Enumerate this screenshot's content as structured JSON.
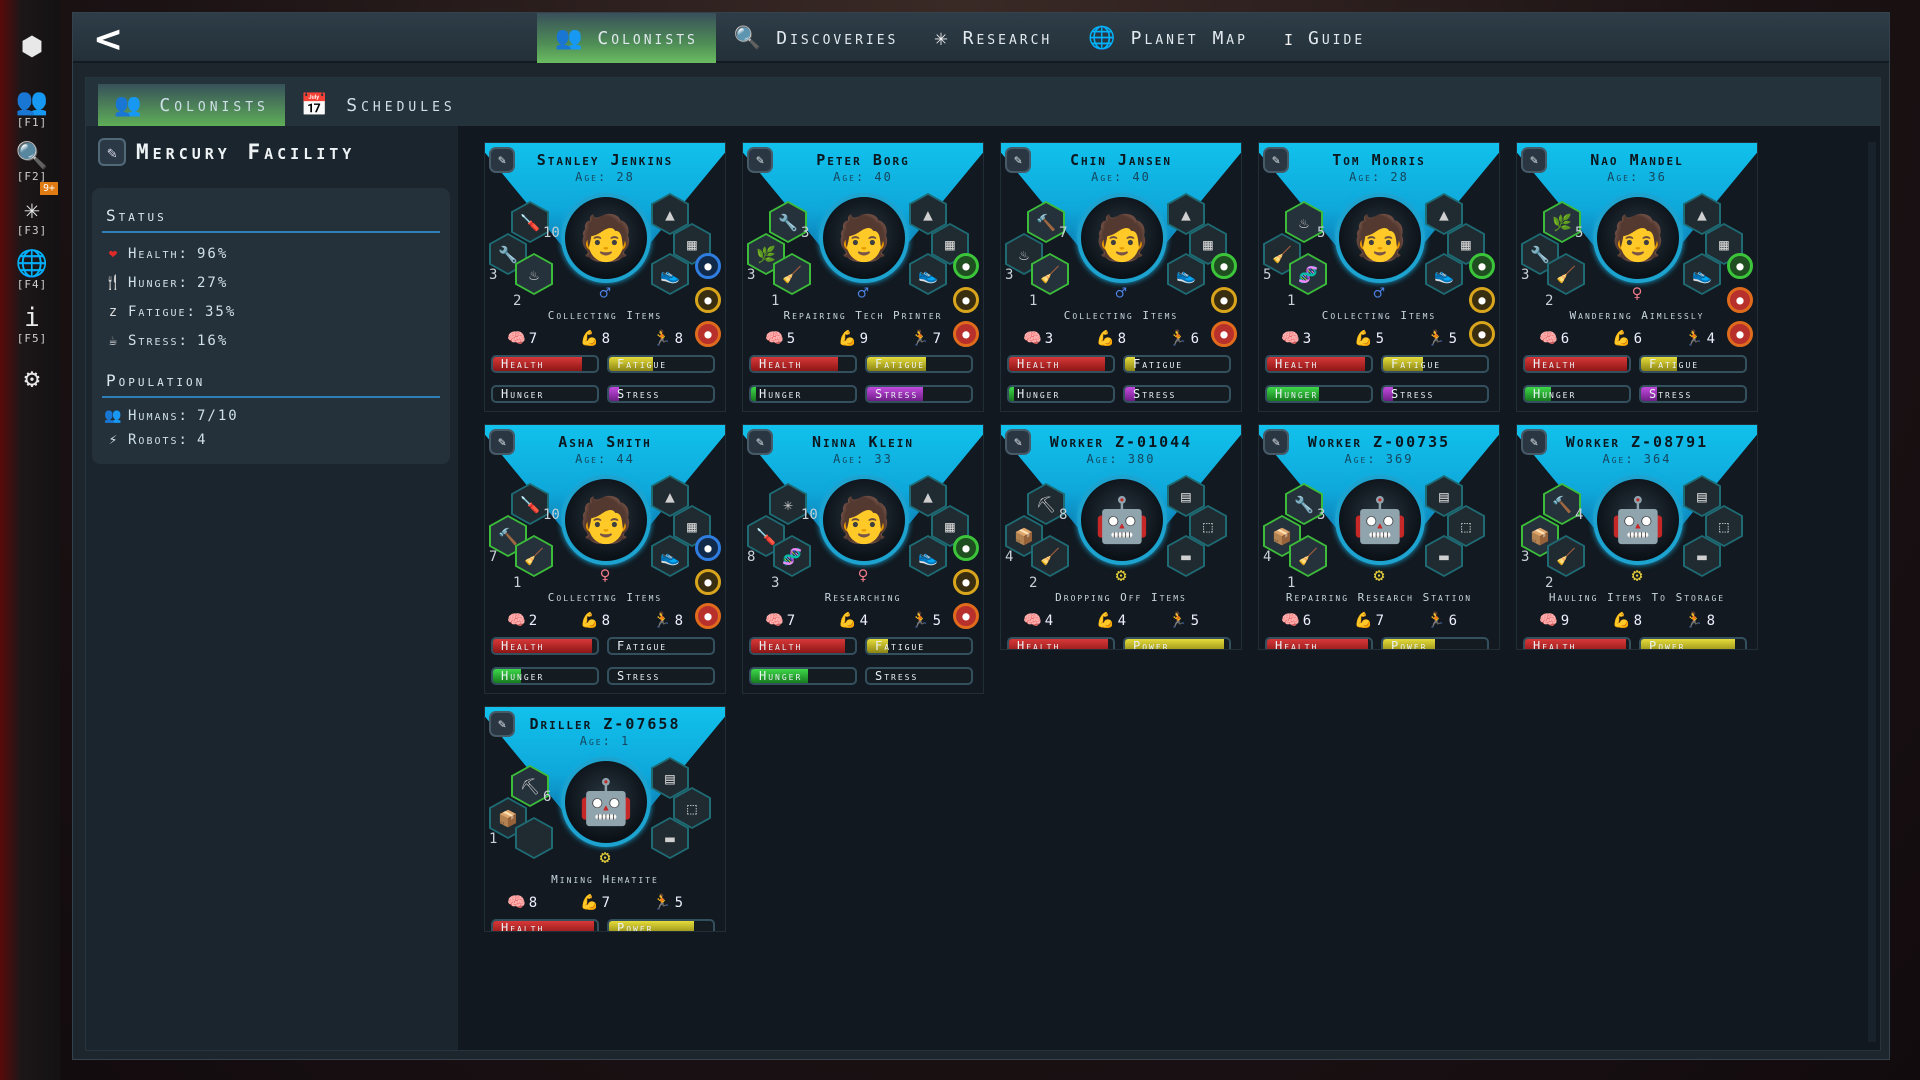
{
  "dock": [
    {
      "icon": "cubes-icon",
      "glyph": "⬢",
      "key": ""
    },
    {
      "icon": "colonists-icon",
      "glyph": "👥",
      "key": "[F1]"
    },
    {
      "icon": "discoveries-icon",
      "glyph": "🔍",
      "key": "[F2]"
    },
    {
      "icon": "research-icon",
      "glyph": "✳",
      "key": "[F3]",
      "badge": "9+"
    },
    {
      "icon": "globe-icon",
      "glyph": "🌐",
      "key": "[F4]"
    },
    {
      "icon": "info-icon",
      "glyph": "i",
      "key": "[F5]"
    },
    {
      "icon": "settings-icon",
      "glyph": "⚙",
      "key": ""
    }
  ],
  "topbar": {
    "back": "<",
    "tabs": [
      {
        "label": "Colonists",
        "glyph": "👥",
        "active": true
      },
      {
        "label": "Discoveries",
        "glyph": "🔍",
        "active": false
      },
      {
        "label": "Research",
        "glyph": "✳",
        "active": false
      },
      {
        "label": "Planet Map",
        "glyph": "🌐",
        "active": false
      },
      {
        "label": "Guide",
        "glyph": "i",
        "active": false
      }
    ]
  },
  "subtabs": [
    {
      "label": "Colonists",
      "glyph": "👥",
      "active": true
    },
    {
      "label": "Schedules",
      "glyph": "📅",
      "active": false
    }
  ],
  "facility": {
    "name": "Mercury Facility",
    "status_heading": "Status",
    "status": [
      {
        "icon": "heart-icon",
        "glyph": "❤",
        "color": "#e02a2a",
        "label": "Health:",
        "value": "96%"
      },
      {
        "icon": "cutlery-icon",
        "glyph": "🍴",
        "color": "#dddddd",
        "label": "Hunger:",
        "value": "27%"
      },
      {
        "icon": "sleep-icon",
        "glyph": "z",
        "color": "#dddddd",
        "label": "Fatigue:",
        "value": "35%"
      },
      {
        "icon": "stress-icon",
        "glyph": "☕",
        "color": "#dddddd",
        "label": "Stress:",
        "value": "16%"
      }
    ],
    "population_heading": "Population",
    "population": [
      {
        "icon": "humans-icon",
        "glyph": "👥",
        "label": "Humans:",
        "value": "7/10"
      },
      {
        "icon": "robots-icon",
        "glyph": "⚡",
        "label": "Robots:",
        "value": "4"
      }
    ]
  },
  "colors": {
    "accent_green": "#5fae57",
    "header_cyan": "#11c1ec"
  },
  "cards": [
    {
      "name": "Stanley Jenkins",
      "age": "Age: 28",
      "type": "human",
      "gender": "m",
      "activity": "Collecting Items",
      "skills": [
        {
          "icon": "screwdriver-icon",
          "g": "🪛",
          "n": "10",
          "green": false
        },
        {
          "icon": "wrench-icon",
          "g": "🔧",
          "n": "3",
          "green": false
        },
        {
          "icon": "cooking-icon",
          "g": "♨",
          "n": "2",
          "green": true
        }
      ],
      "attrs": [
        "7",
        "8",
        "8"
      ],
      "moods": [
        {
          "c": "blue",
          "icon": "broom-mood-icon"
        },
        {
          "c": "yellow",
          "icon": "strong-mood-icon"
        },
        {
          "c": "orange",
          "icon": "sad-mood-icon"
        }
      ],
      "bars": [
        {
          "k": "health",
          "label": "Health",
          "v": 0.86
        },
        {
          "k": "fatigue",
          "label": "Fatigue",
          "v": 0.42
        },
        {
          "k": "hunger",
          "label": "Hunger",
          "v": 0.0
        },
        {
          "k": "stress",
          "label": "Stress",
          "v": 0.1
        }
      ]
    },
    {
      "name": "Peter Borg",
      "age": "Age: 40",
      "type": "human",
      "gender": "m",
      "activity": "Repairing Tech Printer",
      "skills": [
        {
          "icon": "wrench-icon",
          "g": "🔧",
          "n": "3",
          "green": true
        },
        {
          "icon": "botany-icon",
          "g": "🌿",
          "n": "3",
          "green": true
        },
        {
          "icon": "broom-icon",
          "g": "🧹",
          "n": "1",
          "green": true
        }
      ],
      "attrs": [
        "5",
        "9",
        "7"
      ],
      "moods": [
        {
          "c": "green",
          "icon": "food-mood-icon"
        },
        {
          "c": "yellow",
          "icon": "mining-mood-icon"
        },
        {
          "c": "orange",
          "icon": "sad-mood-icon"
        }
      ],
      "bars": [
        {
          "k": "health",
          "label": "Health",
          "v": 0.84
        },
        {
          "k": "fatigue",
          "label": "Fatigue",
          "v": 0.57
        },
        {
          "k": "hunger",
          "label": "Hunger",
          "v": 0.05
        },
        {
          "k": "stress",
          "label": "Stress",
          "v": 0.54
        }
      ]
    },
    {
      "name": "Chin Jansen",
      "age": "Age: 40",
      "type": "human",
      "gender": "m",
      "activity": "Collecting Items",
      "skills": [
        {
          "icon": "hammer-icon",
          "g": "🔨",
          "n": "7",
          "green": true
        },
        {
          "icon": "cooking-icon",
          "g": "♨",
          "n": "3",
          "green": false
        },
        {
          "icon": "broom-icon",
          "g": "🧹",
          "n": "1",
          "green": true
        }
      ],
      "attrs": [
        "3",
        "8",
        "6"
      ],
      "moods": [
        {
          "c": "green",
          "icon": "meat-mood-icon"
        },
        {
          "c": "yellow",
          "icon": "run-mood-icon"
        },
        {
          "c": "orange",
          "icon": "sad-mood-icon"
        }
      ],
      "bars": [
        {
          "k": "health",
          "label": "Health",
          "v": 0.92
        },
        {
          "k": "fatigue",
          "label": "Fatigue",
          "v": 0.1
        },
        {
          "k": "hunger",
          "label": "Hunger",
          "v": 0.05
        },
        {
          "k": "stress",
          "label": "Stress",
          "v": 0.1
        }
      ]
    },
    {
      "name": "Tom Morris",
      "age": "Age: 28",
      "type": "human",
      "gender": "m",
      "activity": "Collecting Items",
      "skills": [
        {
          "icon": "cooking-icon",
          "g": "♨",
          "n": "5",
          "green": true
        },
        {
          "icon": "broom-icon",
          "g": "🧹",
          "n": "5",
          "green": false
        },
        {
          "icon": "dna-icon",
          "g": "🧬",
          "n": "1",
          "green": true
        }
      ],
      "attrs": [
        "3",
        "5",
        "5"
      ],
      "moods": [
        {
          "c": "green",
          "icon": "relax-mood-icon"
        },
        {
          "c": "yellow",
          "icon": "strong-mood-icon"
        },
        {
          "c": "yellow",
          "icon": "relax-mood-icon"
        }
      ],
      "bars": [
        {
          "k": "health",
          "label": "Health",
          "v": 0.94
        },
        {
          "k": "fatigue",
          "label": "Fatigue",
          "v": 0.38
        },
        {
          "k": "hunger",
          "label": "Hunger",
          "v": 0.5
        },
        {
          "k": "stress",
          "label": "Stress",
          "v": 0.1
        }
      ]
    },
    {
      "name": "Nao Mandel",
      "age": "Age: 36",
      "type": "human",
      "gender": "f",
      "activity": "Wandering Aimlessly",
      "skills": [
        {
          "icon": "botany-icon",
          "g": "🌿",
          "n": "5",
          "green": true
        },
        {
          "icon": "wrench-icon",
          "g": "🔧",
          "n": "3",
          "green": false
        },
        {
          "icon": "broom-icon",
          "g": "🧹",
          "n": "2",
          "green": false
        }
      ],
      "attrs": [
        "6",
        "6",
        "4"
      ],
      "moods": [
        {
          "c": "green",
          "icon": "food-mood-icon"
        },
        {
          "c": "orange",
          "icon": "run-mood-icon"
        },
        {
          "c": "orange",
          "icon": "sick-mood-icon"
        }
      ],
      "bars": [
        {
          "k": "health",
          "label": "Health",
          "v": 0.98
        },
        {
          "k": "fatigue",
          "label": "Fatigue",
          "v": 0.35
        },
        {
          "k": "hunger",
          "label": "Hunger",
          "v": 0.25
        },
        {
          "k": "stress",
          "label": "Stress",
          "v": 0.15
        }
      ]
    },
    {
      "name": "Asha Smith",
      "age": "Age: 44",
      "type": "human",
      "gender": "f",
      "activity": "Collecting Items",
      "skills": [
        {
          "icon": "screwdriver-icon",
          "g": "🪛",
          "n": "10",
          "green": false
        },
        {
          "icon": "hammer-icon",
          "g": "🔨",
          "n": "7",
          "green": true
        },
        {
          "icon": "broom-icon",
          "g": "🧹",
          "n": "1",
          "green": true
        }
      ],
      "attrs": [
        "2",
        "8",
        "8"
      ],
      "moods": [
        {
          "c": "blue",
          "icon": "heartbeat-mood-icon"
        },
        {
          "c": "yellow",
          "icon": "relax-mood-icon"
        },
        {
          "c": "orange",
          "icon": "sad-mood-icon"
        }
      ],
      "bars": [
        {
          "k": "health",
          "label": "Health",
          "v": 0.95
        },
        {
          "k": "fatigue",
          "label": "Fatigue",
          "v": 0.0
        },
        {
          "k": "hunger",
          "label": "Hunger",
          "v": 0.27
        },
        {
          "k": "stress",
          "label": "Stress",
          "v": 0.0
        }
      ]
    },
    {
      "name": "Ninna Klein",
      "age": "Age: 33",
      "type": "human",
      "gender": "f",
      "activity": "Researching",
      "skills": [
        {
          "icon": "research-icon",
          "g": "✳",
          "n": "10",
          "green": false
        },
        {
          "icon": "screwdriver-icon",
          "g": "🪛",
          "n": "8",
          "green": false
        },
        {
          "icon": "dna-icon",
          "g": "🧬",
          "n": "3",
          "green": false
        }
      ],
      "attrs": [
        "7",
        "4",
        "5"
      ],
      "moods": [
        {
          "c": "green",
          "icon": "work-mood-icon"
        },
        {
          "c": "yellow",
          "icon": "food-mood-icon"
        },
        {
          "c": "orange",
          "icon": "sad-mood-icon"
        }
      ],
      "bars": [
        {
          "k": "health",
          "label": "Health",
          "v": 0.9
        },
        {
          "k": "fatigue",
          "label": "Fatigue",
          "v": 0.2
        },
        {
          "k": "hunger",
          "label": "Hunger",
          "v": 0.55
        },
        {
          "k": "stress",
          "label": "Stress",
          "v": 0.0
        }
      ]
    },
    {
      "name": "Worker Z-01044",
      "age": "Age: 380",
      "type": "robot",
      "activity": "Dropping Off Items",
      "skills": [
        {
          "icon": "pickaxe-icon",
          "g": "⛏",
          "n": "8",
          "green": false
        },
        {
          "icon": "crate-icon",
          "g": "📦",
          "n": "4",
          "green": false
        },
        {
          "icon": "broom-icon",
          "g": "🧹",
          "n": "2",
          "green": false
        }
      ],
      "attrs": [
        "4",
        "4",
        "5"
      ],
      "moods": [],
      "bars": [
        {
          "k": "health",
          "label": "Health",
          "v": 0.95
        },
        {
          "k": "power",
          "label": "Power",
          "v": 0.95
        }
      ]
    },
    {
      "name": "Worker Z-00735",
      "age": "Age: 369",
      "type": "robot",
      "activity": "Repairing Research Station",
      "skills": [
        {
          "icon": "wrench-icon",
          "g": "🔧",
          "n": "3",
          "green": true
        },
        {
          "icon": "crate-icon",
          "g": "📦",
          "n": "4",
          "green": true
        },
        {
          "icon": "broom-icon",
          "g": "🧹",
          "n": "1",
          "green": true
        }
      ],
      "attrs": [
        "6",
        "7",
        "6"
      ],
      "moods": [],
      "bars": [
        {
          "k": "health",
          "label": "Health",
          "v": 0.97
        },
        {
          "k": "power",
          "label": "Power",
          "v": 0.5
        }
      ]
    },
    {
      "name": "Worker Z-08791",
      "age": "Age: 364",
      "type": "robot",
      "activity": "Hauling Items To Storage",
      "skills": [
        {
          "icon": "hammer-icon",
          "g": "🔨",
          "n": "4",
          "green": true
        },
        {
          "icon": "crate-icon",
          "g": "📦",
          "n": "3",
          "green": true
        },
        {
          "icon": "broom-icon",
          "g": "🧹",
          "n": "2",
          "green": false
        }
      ],
      "attrs": [
        "9",
        "8",
        "8"
      ],
      "moods": [],
      "bars": [
        {
          "k": "health",
          "label": "Health",
          "v": 0.97
        },
        {
          "k": "power",
          "label": "Power",
          "v": 0.9
        }
      ]
    },
    {
      "name": "Driller Z-07658",
      "age": "Age: 1",
      "type": "robot",
      "activity": "Mining Hematite",
      "skills": [
        {
          "icon": "pickaxe-icon",
          "g": "⛏",
          "n": "6",
          "green": true
        },
        {
          "icon": "crate-icon",
          "g": "📦",
          "n": "1",
          "green": false
        },
        {
          "icon": "empty-slot-icon",
          "g": "",
          "n": "",
          "green": false
        }
      ],
      "attrs": [
        "8",
        "7",
        "5"
      ],
      "moods": [],
      "bars": [
        {
          "k": "health",
          "label": "Health",
          "v": 0.97
        },
        {
          "k": "power",
          "label": "Power",
          "v": 0.82
        }
      ]
    }
  ]
}
